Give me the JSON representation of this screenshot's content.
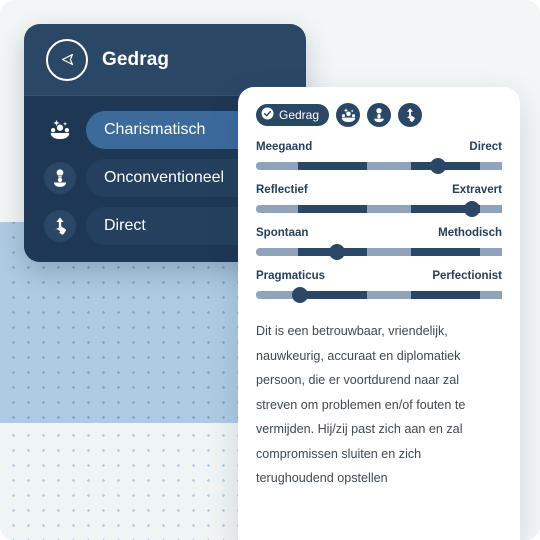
{
  "theme": {
    "dark_navy": "#2b4766",
    "panel_body": "#1e3754",
    "active_pill": "#3c6a9b",
    "track_light": "#8fa3bb",
    "dots_blue": "#aecbe3",
    "canvas": "#f2f6f7"
  },
  "left_panel": {
    "header": {
      "icon": "paper-plane-left-icon",
      "title": "Gedrag"
    },
    "menu": [
      {
        "label": "Charismatisch",
        "icon": "sparkle-group-icon",
        "active": true
      },
      {
        "label": "Onconventioneel",
        "icon": "lightbulb-person-icon",
        "active": false
      },
      {
        "label": "Direct",
        "icon": "arrow-up-hand-icon",
        "active": false
      }
    ]
  },
  "card": {
    "chips": [
      {
        "label": "Gedrag",
        "icon": "check-circle-icon",
        "type": "pill"
      },
      {
        "label": "",
        "icon": "sparkle-group-icon",
        "type": "icon"
      },
      {
        "label": "",
        "icon": "lightbulb-person-icon",
        "type": "icon"
      },
      {
        "label": "",
        "icon": "arrow-up-hand-icon",
        "type": "icon"
      }
    ],
    "sliders": [
      {
        "left_label": "Meegaand",
        "right_label": "Direct",
        "value_percent": 72
      },
      {
        "left_label": "Reflectief",
        "right_label": "Extravert",
        "value_percent": 88
      },
      {
        "left_label": "Spontaan",
        "right_label": "Methodisch",
        "value_percent": 33
      },
      {
        "left_label": "Pragmaticus",
        "right_label": "Perfectionist",
        "value_percent": 18
      }
    ],
    "description": "Dit is een betrouwbaar, vriendelijk, nauwkeurig, accuraat en diplomatiek persoon, die er voortdurend naar zal streven om problemen en/of fouten te vermijden. Hij/zij past zich aan en zal compromissen sluiten en zich terughoudend opstellen"
  }
}
